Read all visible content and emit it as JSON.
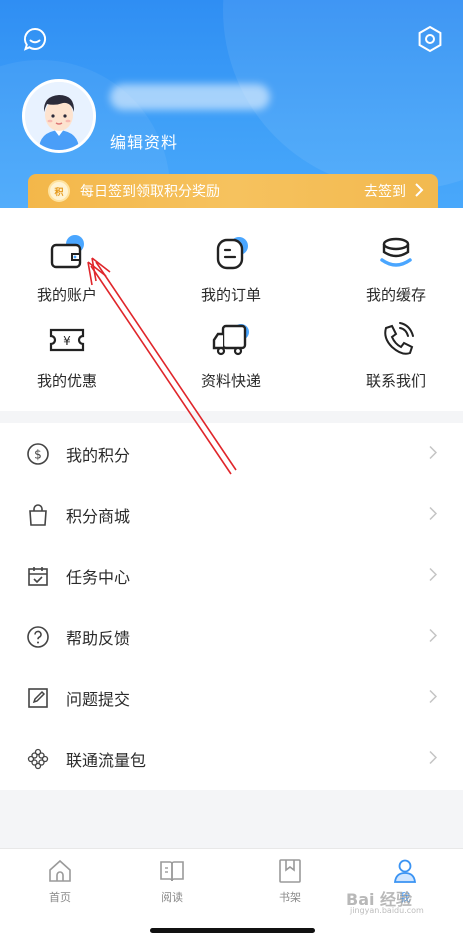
{
  "header": {
    "edit_profile": "编辑资料",
    "signin": {
      "text": "每日签到领取积分奖励",
      "action": "去签到",
      "coin_label": "积"
    }
  },
  "grid": [
    {
      "label": "我的账户",
      "icon": "wallet-icon"
    },
    {
      "label": "我的订单",
      "icon": "order-icon"
    },
    {
      "label": "我的缓存",
      "icon": "cache-icon"
    },
    {
      "label": "我的优惠",
      "icon": "coupon-icon"
    },
    {
      "label": "资料快递",
      "icon": "delivery-truck-icon"
    },
    {
      "label": "联系我们",
      "icon": "phone-icon"
    }
  ],
  "menu": [
    {
      "label": "我的积分",
      "icon": "points-coin-icon"
    },
    {
      "label": "积分商城",
      "icon": "shopping-bag-icon"
    },
    {
      "label": "任务中心",
      "icon": "calendar-task-icon"
    },
    {
      "label": "帮助反馈",
      "icon": "help-icon"
    },
    {
      "label": "问题提交",
      "icon": "edit-icon"
    },
    {
      "label": "联通流量包",
      "icon": "unicom-knot-icon"
    }
  ],
  "tabbar": [
    {
      "label": "首页",
      "icon": "home-icon",
      "active": false
    },
    {
      "label": "阅读",
      "icon": "read-book-icon",
      "active": false
    },
    {
      "label": "书架",
      "icon": "bookshelf-icon",
      "active": false
    },
    {
      "label": "我",
      "icon": "profile-icon",
      "active": true
    }
  ],
  "watermark": {
    "text": "Bai 经验",
    "sub": "jingyan.baidu.com"
  },
  "colors": {
    "header_blue": "#2f8ef3",
    "banner_orange": "#f3b74a",
    "accent": "#3a93f3",
    "annotation_red": "#e0262b"
  }
}
